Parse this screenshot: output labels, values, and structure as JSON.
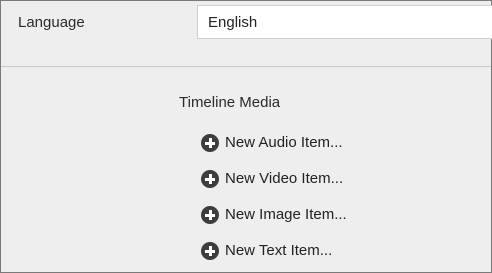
{
  "language": {
    "label": "Language",
    "value": "English"
  },
  "timeline_media": {
    "title": "Timeline Media",
    "items": [
      {
        "label": "New Audio Item...",
        "icon": "plus-circle-icon"
      },
      {
        "label": "New Video Item...",
        "icon": "plus-circle-icon"
      },
      {
        "label": "New Image Item...",
        "icon": "plus-circle-icon"
      },
      {
        "label": "New Text Item...",
        "icon": "plus-circle-icon"
      }
    ]
  },
  "colors": {
    "background": "#eeeeee",
    "icon": "#3d3d3d",
    "input_background": "#ffffff",
    "border": "#7a7a7a"
  }
}
